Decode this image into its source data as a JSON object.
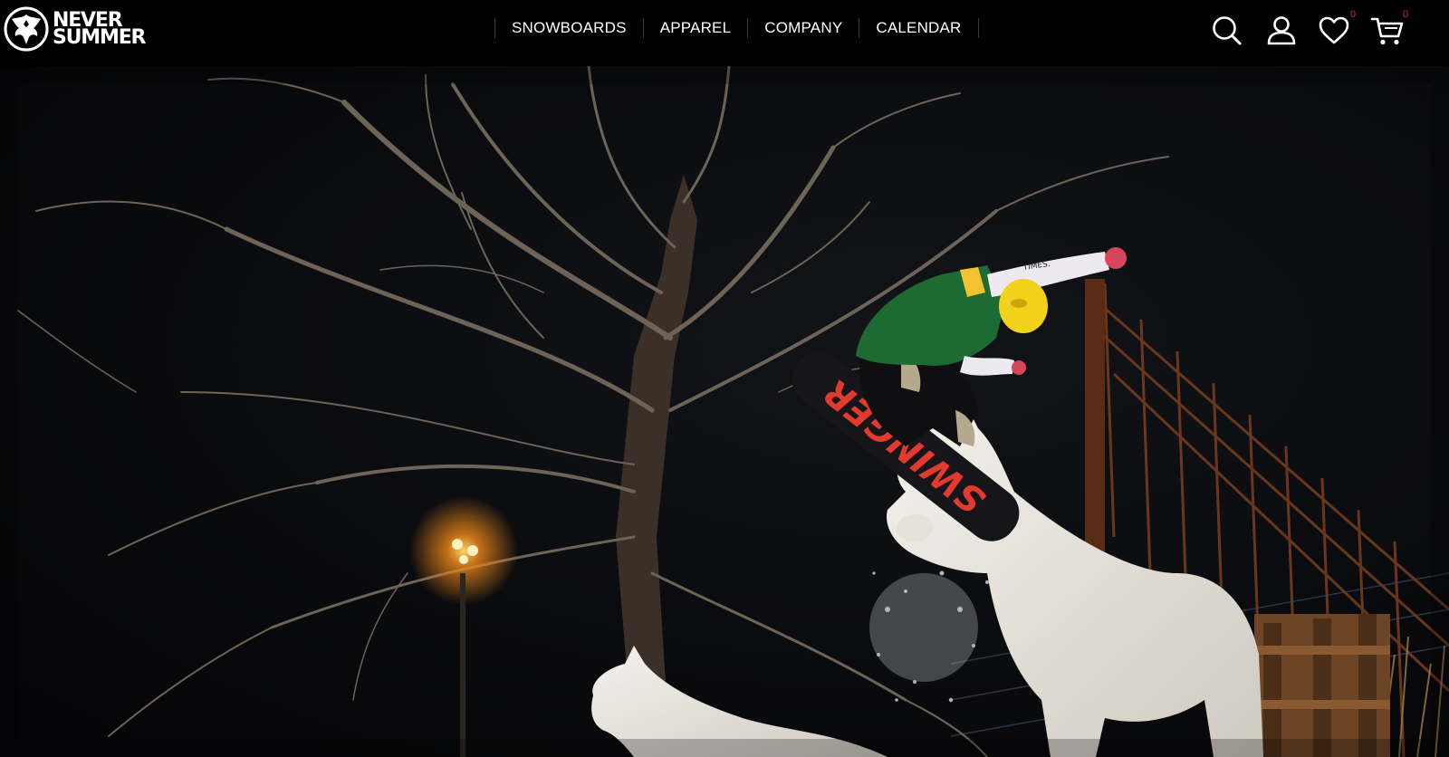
{
  "brand": {
    "name_line1": "NEVER",
    "name_line2": "SUMMER"
  },
  "nav": {
    "items": [
      {
        "label": "SNOWBOARDS"
      },
      {
        "label": "APPAREL"
      },
      {
        "label": "COMPANY"
      },
      {
        "label": "CALENDAR"
      }
    ]
  },
  "header_icons": {
    "search": "search-icon",
    "account": "user-icon",
    "wishlist": "heart-icon",
    "wishlist_count": "0",
    "cart": "cart-icon",
    "cart_count": "0"
  },
  "hero": {
    "board_graphic_text": "SWINGER",
    "sleeve_text": "TIMES."
  },
  "colors": {
    "header_bg": "#000000",
    "badge": "#d0342c",
    "board_accent": "#e23a2f"
  }
}
